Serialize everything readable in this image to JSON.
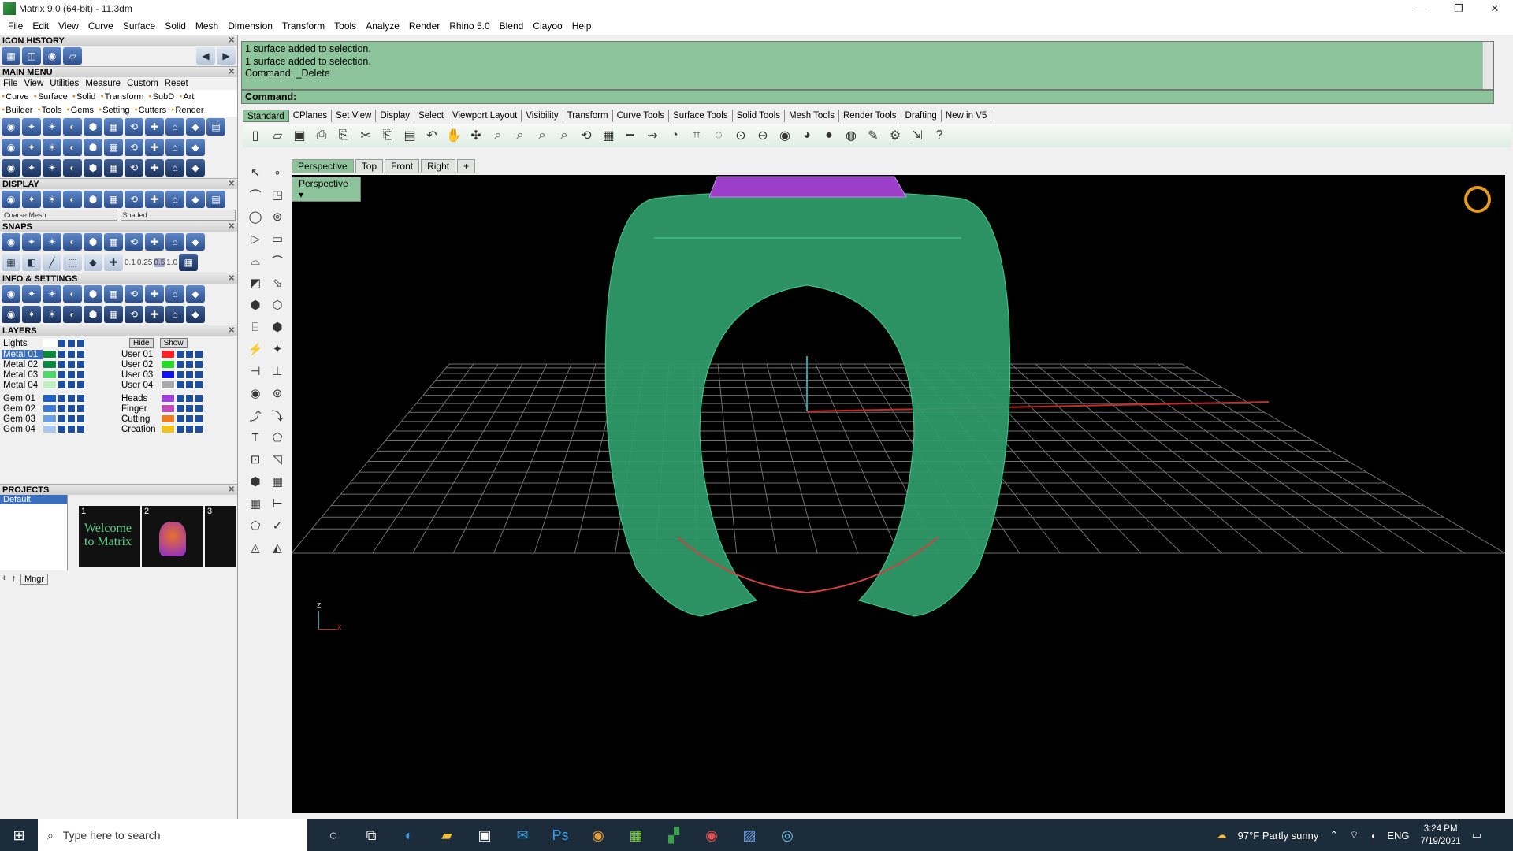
{
  "window": {
    "title": "Matrix 9.0 (64-bit) - 11.3dm",
    "controls": [
      "—",
      "❐",
      "✕"
    ]
  },
  "menubar": [
    "File",
    "Edit",
    "View",
    "Curve",
    "Surface",
    "Solid",
    "Mesh",
    "Dimension",
    "Transform",
    "Tools",
    "Analyze",
    "Render",
    "Rhino 5.0",
    "Blend",
    "Clayoo",
    "Help"
  ],
  "left": {
    "icon_history": "ICON HISTORY",
    "main_menu": "MAIN MENU",
    "main_menu_items": [
      "File",
      "View",
      "Utilities",
      "Measure",
      "Custom",
      "Reset"
    ],
    "mm_row1": [
      "Curve",
      "Surface",
      "Solid",
      "Transform",
      "SubD",
      "Art"
    ],
    "mm_row2": [
      "Builder",
      "Tools",
      "Gems",
      "Setting",
      "Cutters",
      "Render"
    ],
    "display": "DISPLAY",
    "display_mesh": "Coarse Mesh",
    "display_mode": "Shaded",
    "snaps": "SNAPS",
    "snap_values": [
      "0.1",
      "0.25",
      "0.5",
      "1.0"
    ],
    "info": "INFO & SETTINGS",
    "layers": "LAYERS",
    "layer_lights": "Lights",
    "hide": "Hide",
    "show": "Show",
    "layer_col1": [
      "Metal 01",
      "Metal 02",
      "Metal 03",
      "Metal 04",
      "Gem 01",
      "Gem 02",
      "Gem 03",
      "Gem 04"
    ],
    "layer_col2": [
      "User 01",
      "User 02",
      "User 03",
      "User 04",
      "Heads",
      "Finger",
      "Cutting",
      "Creation"
    ],
    "layer_col1_colors": [
      "#0a8a3c",
      "#0a8a3c",
      "#4ed86b",
      "#bff0c2",
      "#1d5fc4",
      "#3e78d6",
      "#6aa0e4",
      "#a8c8f2"
    ],
    "layer_col2_colors": [
      "#ff1d1d",
      "#22dd22",
      "#1111ee",
      "#aaaaaa",
      "#a23de0",
      "#c44ab8",
      "#f07b1e",
      "#f5c21a"
    ],
    "projects": "PROJECTS",
    "project_default": "Default",
    "project_thumbs": [
      "1",
      "2",
      "3"
    ],
    "thumb_caption": "Welcome to Matrix",
    "mngr": "Mngr"
  },
  "command": {
    "history": [
      "1 surface added to selection.",
      "1 surface added to selection.",
      "Command: _Delete"
    ],
    "prompt": "Command:"
  },
  "toolbar_tabs": [
    "Standard",
    "CPlanes",
    "Set View",
    "Display",
    "Select",
    "Viewport Layout",
    "Visibility",
    "Transform",
    "Curve Tools",
    "Surface Tools",
    "Solid Tools",
    "Mesh Tools",
    "Render Tools",
    "Drafting",
    "New in V5"
  ],
  "viewport_tabs": [
    "Perspective",
    "Top",
    "Front",
    "Right",
    "+"
  ],
  "viewport_label": "Perspective",
  "axis": {
    "z": "z",
    "x": "x"
  },
  "taskbar": {
    "search_placeholder": "Type here to search",
    "weather": "97°F  Partly sunny",
    "lang": "ENG",
    "time": "3:24 PM",
    "date": "7/19/2021"
  }
}
